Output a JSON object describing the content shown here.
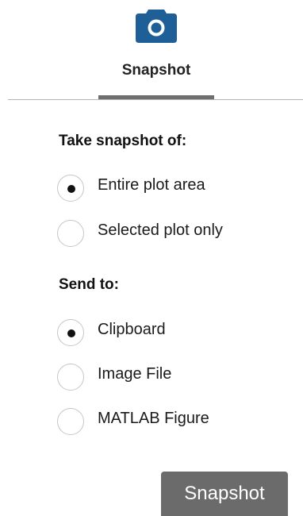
{
  "header": {
    "icon": "camera-icon",
    "tab_label": "Snapshot",
    "icon_color": "#1f5f97"
  },
  "snapshot_of": {
    "heading": "Take snapshot of:",
    "options": [
      {
        "label": "Entire plot area",
        "selected": true
      },
      {
        "label": "Selected plot only",
        "selected": false
      }
    ]
  },
  "send_to": {
    "heading": "Send to:",
    "options": [
      {
        "label": "Clipboard",
        "selected": true
      },
      {
        "label": "Image File",
        "selected": false
      },
      {
        "label": "MATLAB Figure",
        "selected": false
      }
    ]
  },
  "action": {
    "button_label": "Snapshot",
    "button_color": "#6b6b6b"
  }
}
